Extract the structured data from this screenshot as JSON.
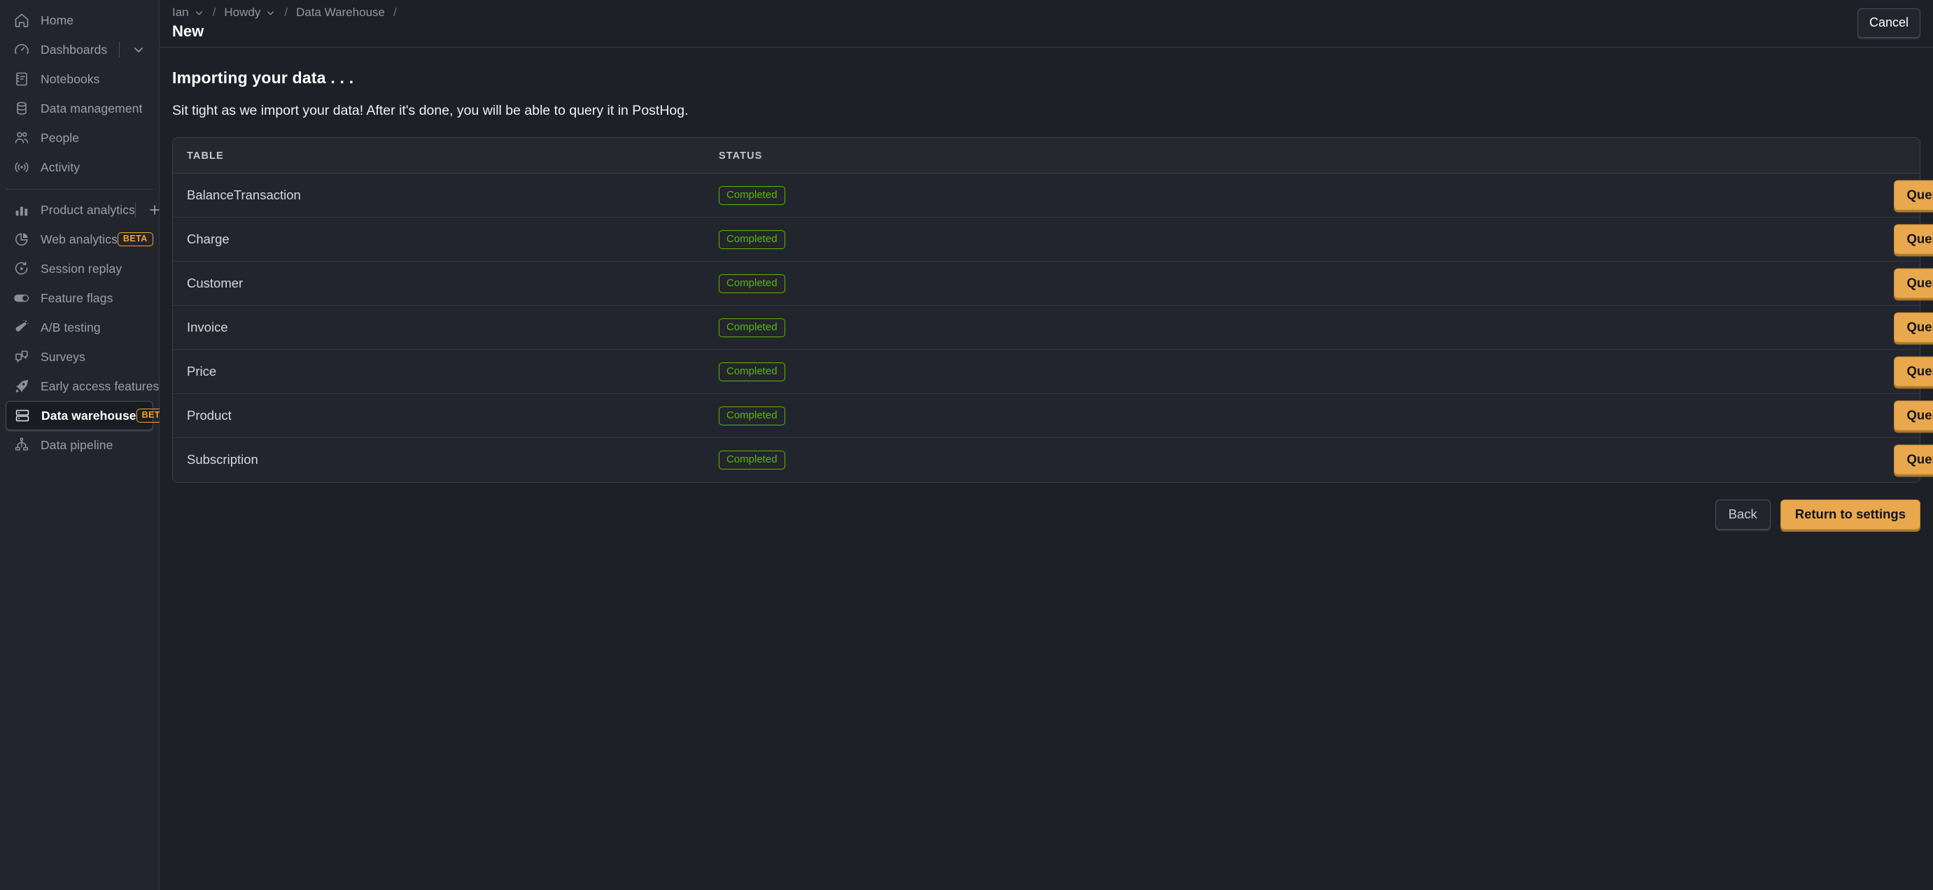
{
  "sidebar": {
    "primary_items": [
      {
        "label": "Home",
        "icon": "home-icon",
        "active": false
      },
      {
        "label": "Dashboards",
        "icon": "dashboards-icon",
        "active": false,
        "has_divider": true,
        "trailing": "chevron-down-icon"
      },
      {
        "label": "Notebooks",
        "icon": "notebook-icon",
        "active": false
      },
      {
        "label": "Data management",
        "icon": "database-icon",
        "active": false
      },
      {
        "label": "People",
        "icon": "people-icon",
        "active": false
      },
      {
        "label": "Activity",
        "icon": "activity-icon",
        "active": false
      }
    ],
    "secondary_items": [
      {
        "label": "Product analytics",
        "icon": "bar-chart-icon",
        "active": false,
        "has_divider": true,
        "trailing": "plus-icon"
      },
      {
        "label": "Web analytics",
        "icon": "pie-chart-icon",
        "active": false,
        "badge": "BETA"
      },
      {
        "label": "Session replay",
        "icon": "play-replay-icon",
        "active": false
      },
      {
        "label": "Feature flags",
        "icon": "toggle-icon",
        "active": false
      },
      {
        "label": "A/B testing",
        "icon": "flask-icon",
        "active": false
      },
      {
        "label": "Surveys",
        "icon": "surveys-icon",
        "active": false
      },
      {
        "label": "Early access features",
        "icon": "rocket-icon",
        "active": false
      },
      {
        "label": "Data warehouse",
        "icon": "warehouse-icon",
        "active": true,
        "badge": "BETA"
      },
      {
        "label": "Data pipeline",
        "icon": "pipeline-icon",
        "active": false
      }
    ]
  },
  "topbar": {
    "breadcrumb": [
      {
        "label": "Ian",
        "has_chevron": true
      },
      {
        "label": "Howdy",
        "has_chevron": true
      },
      {
        "label": "Data Warehouse",
        "has_chevron": false
      }
    ],
    "separator": "/",
    "page_title": "New",
    "cancel_label": "Cancel"
  },
  "content": {
    "heading": "Importing your data . . .",
    "subtitle": "Sit tight as we import your data! After it's done, you will be able to query it in PostHog.",
    "table": {
      "columns": [
        "TABLE",
        "STATUS",
        ""
      ],
      "rows": [
        {
          "table": "BalanceTransaction",
          "status": "Completed",
          "action": "Query"
        },
        {
          "table": "Charge",
          "status": "Completed",
          "action": "Query"
        },
        {
          "table": "Customer",
          "status": "Completed",
          "action": "Query"
        },
        {
          "table": "Invoice",
          "status": "Completed",
          "action": "Query"
        },
        {
          "table": "Price",
          "status": "Completed",
          "action": "Query"
        },
        {
          "table": "Product",
          "status": "Completed",
          "action": "Query"
        },
        {
          "table": "Subscription",
          "status": "Completed",
          "action": "Query"
        }
      ]
    },
    "footer": {
      "back_label": "Back",
      "primary_label": "Return to settings"
    }
  },
  "colors": {
    "accent": "#e9a84d",
    "beta_badge": "#f5a623",
    "status_completed": "#5cb800",
    "sidebar_bg": "#22252d",
    "main_bg": "#1d2027"
  }
}
